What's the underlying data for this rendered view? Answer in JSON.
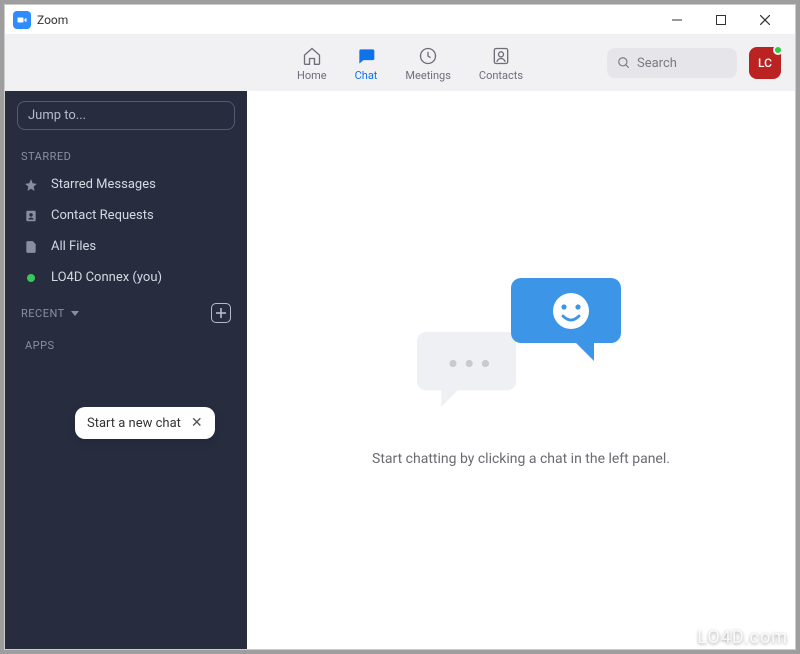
{
  "window": {
    "title": "Zoom"
  },
  "nav": {
    "tabs": [
      {
        "label": "Home"
      },
      {
        "label": "Chat"
      },
      {
        "label": "Meetings"
      },
      {
        "label": "Contacts"
      }
    ],
    "active_index": 1,
    "search_placeholder": "Search",
    "avatar_initials": "LC"
  },
  "sidebar": {
    "jump_placeholder": "Jump to...",
    "sections": {
      "starred_label": "STARRED",
      "recent_label": "RECENT",
      "apps_label": "APPS"
    },
    "starred_items": [
      {
        "label": "Starred Messages",
        "icon": "star"
      },
      {
        "label": "Contact Requests",
        "icon": "contact"
      },
      {
        "label": "All Files",
        "icon": "file"
      },
      {
        "label": "LO4D Connex (you)",
        "icon": "presence"
      }
    ],
    "tooltip": "Start a new chat"
  },
  "main": {
    "empty_text": "Start chatting by clicking a chat in the left panel."
  },
  "watermark": "LO4D.com"
}
